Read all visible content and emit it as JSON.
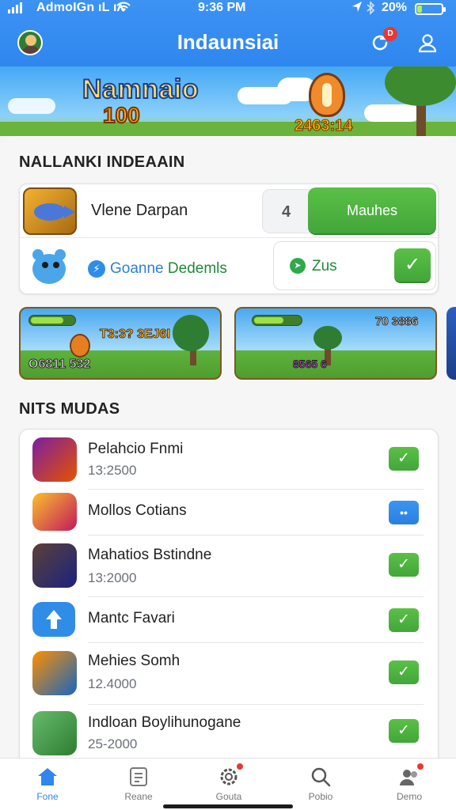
{
  "status": {
    "carrier": "AdmoIGn ıL ıᴧ",
    "time": "9:36 PM",
    "battery": "20%",
    "battery_level": 0.2
  },
  "header": {
    "title": "Indaunsiai",
    "notification_badge": "D"
  },
  "banner": {
    "title": "Namnaio",
    "subtitle": "100",
    "score": "2463:14"
  },
  "section1": {
    "title": "NALLANKI INDEAAIN"
  },
  "featured": {
    "item1": {
      "name": "Vlene Darpan",
      "count": "4",
      "action": "Mauhes"
    },
    "item2": {
      "name_a": "Goanne",
      "name_b": "Dedemls",
      "tag": "Zus",
      "check": "✓"
    }
  },
  "games": [
    {
      "score": "T3:3? 3EJ6I",
      "counter": "O6811 532"
    },
    {
      "score": "70 3886",
      "counter": "8565 6"
    }
  ],
  "section2": {
    "title": "NITS MUDAS"
  },
  "list": [
    {
      "name": "Pelahcio Fnmi",
      "sub": "13:2500",
      "check": "✓",
      "type": "green",
      "icon": "game-hero-icon"
    },
    {
      "name": "Mollos Cotians",
      "sub": "",
      "check": "••",
      "type": "blue",
      "icon": "game-logo-icon"
    },
    {
      "name": "Mahatios Bstindne",
      "sub": "13:2000",
      "check": "✓",
      "type": "green",
      "icon": "game-portrait-icon"
    },
    {
      "name": "Mantc Favari",
      "sub": "",
      "check": "✓",
      "type": "green",
      "icon": "arrow-up-icon"
    },
    {
      "name": "Mehies Somh",
      "sub": "12.4000",
      "check": "✓",
      "type": "green",
      "icon": "game-warrior-icon"
    },
    {
      "name": "Indloan Boylihunogane",
      "sub": "25-2000",
      "check": "✓",
      "type": "green",
      "icon": "game-character-icon"
    }
  ],
  "tabs": [
    {
      "label": "Fone",
      "icon": "home-icon",
      "active": true
    },
    {
      "label": "Reane",
      "icon": "document-icon"
    },
    {
      "label": "Gouta",
      "icon": "gear-icon"
    },
    {
      "label": "Pobio",
      "icon": "search-icon"
    },
    {
      "label": "Demo",
      "icon": "people-icon"
    }
  ],
  "colors": {
    "accent": "#2f86ee",
    "success": "#4cb43f",
    "alert": "#e53935"
  }
}
